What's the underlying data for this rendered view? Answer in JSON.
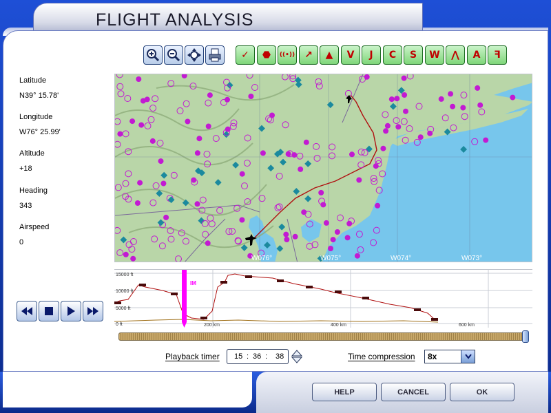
{
  "window": {
    "title": "FLIGHT ANALYSIS"
  },
  "toolbar": {
    "view_tools": [
      {
        "name": "zoom-in-icon"
      },
      {
        "name": "zoom-out-icon"
      },
      {
        "name": "center-map-icon"
      },
      {
        "name": "print-icon"
      }
    ],
    "filters": [
      {
        "name": "check-icon",
        "glyph": "✓"
      },
      {
        "name": "stop-sign-icon",
        "glyph": "⬣"
      },
      {
        "name": "radio-beacon-icon",
        "glyph": "((•))"
      },
      {
        "name": "flight-path-icon",
        "glyph": "↗"
      },
      {
        "name": "triangle-icon",
        "glyph": "▲"
      },
      {
        "name": "vor-icon",
        "glyph": "V"
      },
      {
        "name": "jet-route-icon",
        "glyph": "J"
      },
      {
        "name": "holding-pattern-icon",
        "glyph": "C"
      },
      {
        "name": "airway-icon",
        "glyph": "S"
      },
      {
        "name": "waypoint-icon",
        "glyph": "W"
      },
      {
        "name": "terrain-icon",
        "glyph": "⋀"
      },
      {
        "name": "approach-icon",
        "glyph": "A"
      },
      {
        "name": "procedure-icon",
        "glyph": "ꟻ"
      }
    ]
  },
  "info": {
    "latitude": {
      "label": "Latitude",
      "value": "N39° 15.78'"
    },
    "longitude": {
      "label": "Longitude",
      "value": "W76° 25.99'"
    },
    "altitude": {
      "label": "Altitude",
      "value": "+18"
    },
    "heading": {
      "label": "Heading",
      "value": "343"
    },
    "airspeed": {
      "label": "Airspeed",
      "value": "0"
    }
  },
  "map": {
    "longitude_labels": [
      "W076°",
      "W075°",
      "W074°",
      "W073°"
    ],
    "colors": {
      "land": "#b9d6a8",
      "water": "#77c6ec",
      "airport": "#c21ad2",
      "navaid": "#1b8a9e",
      "route": "#b01010"
    }
  },
  "profile": {
    "y_labels": [
      "15000 ft",
      "10000 ft",
      "5000 ft",
      "0 ft"
    ],
    "x_labels": [
      "200 km",
      "400 km",
      "600 km"
    ],
    "marker_label": "IM",
    "colors": {
      "altitude": "#b01010",
      "ground": "#a0701a",
      "marker": "#ff00ff"
    }
  },
  "playback": {
    "timer_label": "Playback timer",
    "hours": "15",
    "minutes": "36",
    "seconds": "38",
    "compression_label": "Time compression",
    "compression_value": "8x",
    "progress": 1.0
  },
  "buttons": {
    "help": "HELP",
    "cancel": "CANCEL",
    "ok": "OK"
  }
}
